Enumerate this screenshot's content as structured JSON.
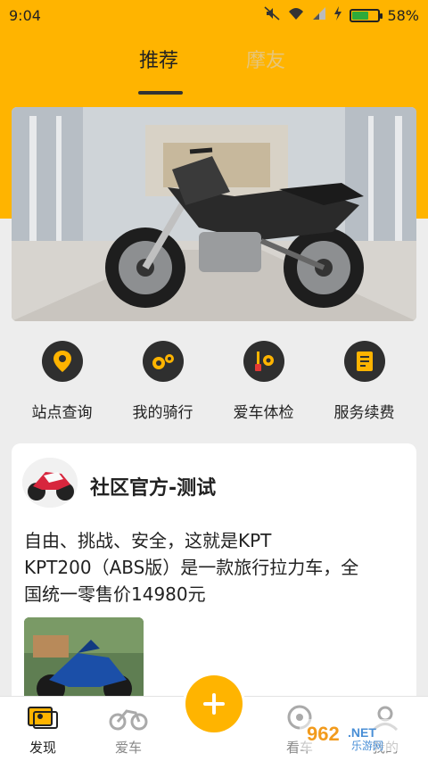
{
  "status_bar": {
    "time": "9:04",
    "battery_percent": "58%",
    "battery_level": 0.58,
    "icons": [
      "mute-icon",
      "wifi-icon",
      "signal-icon",
      "charging-icon",
      "battery-icon"
    ]
  },
  "tabs": [
    {
      "label": "推荐",
      "active": true
    },
    {
      "label": "摩友",
      "active": false
    }
  ],
  "quick_actions": [
    {
      "label": "站点查询",
      "icon": "location-pin-icon"
    },
    {
      "label": "我的骑行",
      "icon": "gears-icon"
    },
    {
      "label": "爱车体检",
      "icon": "tools-icon"
    },
    {
      "label": "服务续费",
      "icon": "document-icon"
    }
  ],
  "post": {
    "author": "社区官方-测试",
    "text_lines": [
      "自由、挑战、安全，这就是KPT",
      "KPT200（ABS版）是一款旅行拉力车，全",
      "国统一零售价14980元"
    ]
  },
  "bottom_nav": [
    {
      "label": "发现",
      "icon": "discover-icon",
      "active": true
    },
    {
      "label": "爱车",
      "icon": "motorcycle-icon",
      "active": false
    },
    {
      "label": "看车",
      "icon": "view-icon",
      "active": false
    },
    {
      "label": "我的",
      "icon": "profile-icon",
      "active": false
    }
  ],
  "fab": {
    "icon": "plus-icon"
  },
  "watermark": {
    "text": "962.NET",
    "sub": "乐游网"
  },
  "colors": {
    "accent": "#ffb400",
    "dark": "#2f2f2f"
  }
}
